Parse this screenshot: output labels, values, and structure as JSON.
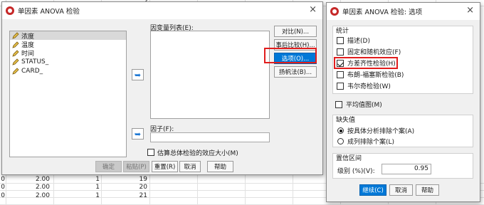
{
  "sheet": {
    "rows": [
      {
        "lead": "0",
        "v1": "2.00",
        "v2": "1",
        "v3": "19"
      },
      {
        "lead": "0",
        "v1": "2.00",
        "v2": "1",
        "v3": "20"
      },
      {
        "lead": "0",
        "v1": "2.00",
        "v2": "1",
        "v3": "21"
      }
    ],
    "top_fragment": "2"
  },
  "main_dialog": {
    "title": "单因素 ANOVA 检验",
    "close_glyph": "×",
    "variables": [
      "浓度",
      "温度",
      "时间",
      "STATUS_",
      "CARD_"
    ],
    "dependent_label": "因变量列表(E):",
    "factor_label": "因子(F):",
    "side_buttons": {
      "contrasts": "对比(N)...",
      "posthoc": "事后比较(H)...",
      "options": "选项(O)...",
      "bootstrap": "扬帆法(B)..."
    },
    "effect_size_label": "估算总体检验的效应大小(M)",
    "bottom_buttons": {
      "ok": "确定",
      "paste": "粘贴(P)",
      "reset": "重置(R)",
      "cancel": "取消",
      "help": "帮助"
    },
    "arrow_glyph": "➥"
  },
  "options_dialog": {
    "title": "单因素 ANOVA 检验: 选项",
    "close_glyph": "×",
    "stats_header": "统计",
    "stats_items": [
      {
        "label": "描述(D)",
        "checked": false
      },
      {
        "label": "固定和随机效应(F)",
        "checked": false
      },
      {
        "label": "方差齐性检验(H)",
        "checked": true
      },
      {
        "label": "布朗-福塞斯检验(B)",
        "checked": false
      },
      {
        "label": "韦尔奇检验(W)",
        "checked": false
      }
    ],
    "means_plot_label": "平均值图(M)",
    "missing_header": "缺失值",
    "missing_items": [
      {
        "label": "按具体分析排除个案(A)",
        "checked": true
      },
      {
        "label": "成列排除个案(L)",
        "checked": false
      }
    ],
    "ci_header": "置信区间",
    "ci_level_label": "级别 (%)(V):",
    "ci_level_value": "0.95",
    "buttons": {
      "continue": "继续(C)",
      "cancel": "取消",
      "help": "帮助"
    }
  },
  "colors": {
    "highlight_red": "#e11d1d",
    "focus_blue": "#0078d7",
    "arrow_blue": "#1e78d4",
    "dialog_bg": "#f0f0f0"
  }
}
